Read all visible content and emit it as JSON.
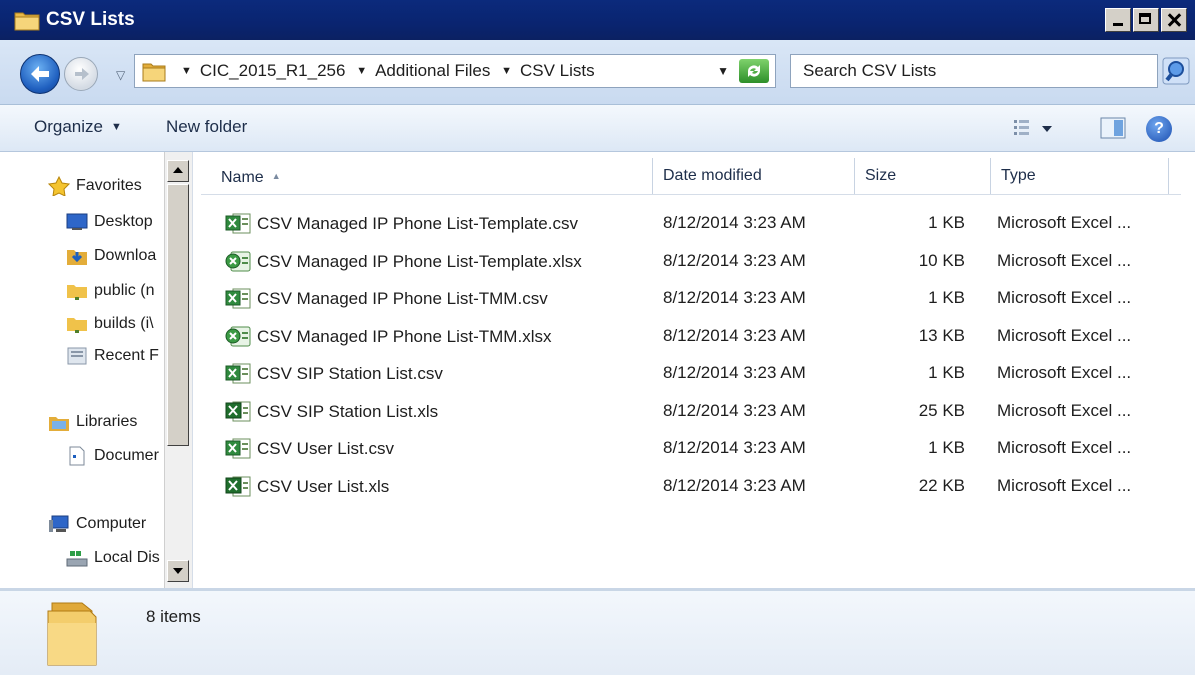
{
  "window": {
    "title": "CSV Lists"
  },
  "address": {
    "crumbs": [
      "CIC_2015_R1_256",
      "Additional Files",
      "CSV Lists"
    ]
  },
  "search": {
    "placeholder": "Search CSV Lists"
  },
  "toolbar": {
    "organize_label": "Organize",
    "new_folder_label": "New folder"
  },
  "navigation": {
    "favorites_label": "Favorites",
    "favorites": [
      "Desktop",
      "Downloa",
      "public (n",
      "builds (i\\",
      "Recent F"
    ],
    "libraries_label": "Libraries",
    "libraries": [
      "Documer"
    ],
    "computer_label": "Computer",
    "computer": [
      "Local Dis"
    ]
  },
  "columns": {
    "name": "Name",
    "date": "Date modified",
    "size": "Size",
    "type": "Type"
  },
  "files": [
    {
      "name": "CSV Managed IP Phone List-Template.csv",
      "date": "8/12/2014 3:23 AM",
      "size": "1 KB",
      "type": "Microsoft Excel ...",
      "icon": "csv-file-icon"
    },
    {
      "name": "CSV Managed IP Phone List-Template.xlsx",
      "date": "8/12/2014 3:23 AM",
      "size": "10 KB",
      "type": "Microsoft Excel ...",
      "icon": "xlsx-file-icon"
    },
    {
      "name": "CSV Managed IP Phone List-TMM.csv",
      "date": "8/12/2014 3:23 AM",
      "size": "1 KB",
      "type": "Microsoft Excel ...",
      "icon": "csv-file-icon"
    },
    {
      "name": "CSV Managed IP Phone List-TMM.xlsx",
      "date": "8/12/2014 3:23 AM",
      "size": "13 KB",
      "type": "Microsoft Excel ...",
      "icon": "xlsx-file-icon"
    },
    {
      "name": "CSV SIP Station List.csv",
      "date": "8/12/2014 3:23 AM",
      "size": "1 KB",
      "type": "Microsoft Excel ...",
      "icon": "csv-file-icon"
    },
    {
      "name": "CSV SIP Station List.xls",
      "date": "8/12/2014 3:23 AM",
      "size": "25 KB",
      "type": "Microsoft Excel ...",
      "icon": "xls-file-icon"
    },
    {
      "name": "CSV User List.csv",
      "date": "8/12/2014 3:23 AM",
      "size": "1 KB",
      "type": "Microsoft Excel ...",
      "icon": "csv-file-icon"
    },
    {
      "name": "CSV User List.xls",
      "date": "8/12/2014 3:23 AM",
      "size": "22 KB",
      "type": "Microsoft Excel ...",
      "icon": "xls-file-icon"
    }
  ],
  "status": {
    "item_count": "8 items"
  },
  "colors": {
    "titlebar": "#0a2470",
    "accent": "#1f5fbf",
    "excel_green": "#1f7a33"
  }
}
